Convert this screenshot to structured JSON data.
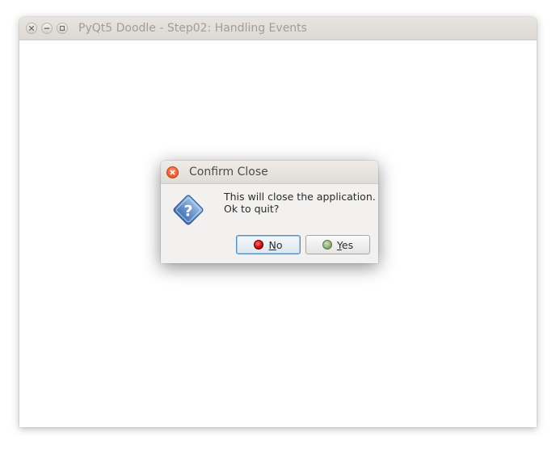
{
  "window": {
    "title": "PyQt5 Doodle - Step02: Handling Events",
    "controls": {
      "close_icon": "close-icon",
      "minimize_icon": "minimize-icon",
      "maximize_icon": "maximize-icon"
    }
  },
  "dialog": {
    "title": "Confirm Close",
    "icon": "question-icon",
    "message_line1": "This will close the application.",
    "message_line2": "Ok to quit?",
    "buttons": {
      "no": {
        "mnemonic": "N",
        "rest": "o",
        "icon": "red-dot-icon"
      },
      "yes": {
        "mnemonic": "Y",
        "rest": "es",
        "icon": "green-dot-icon"
      }
    }
  },
  "colors": {
    "titlebar": "#dcd8d3",
    "dialog_close": "#e55a2e",
    "default_button_border": "#5b8ebf",
    "no_icon": "#c40000",
    "yes_icon": "#8fad76"
  }
}
